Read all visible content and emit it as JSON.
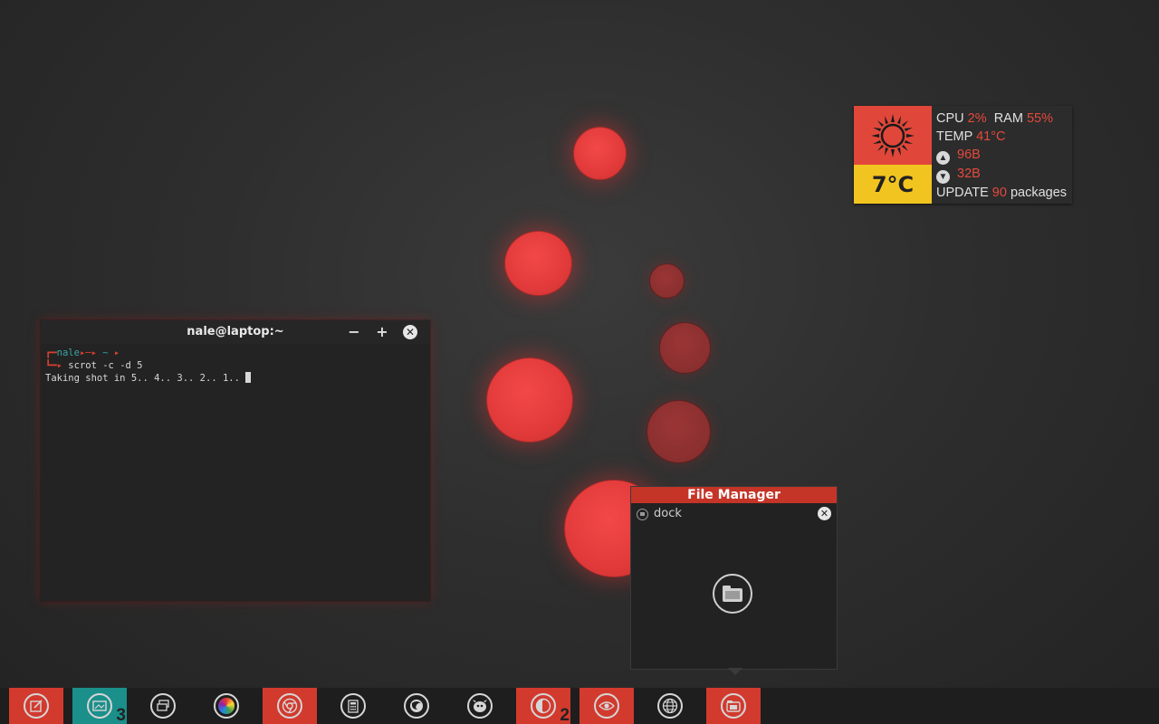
{
  "terminal": {
    "title": "nale@laptop:~",
    "prompt_user": "nale",
    "prompt_tail_1": "▸─▸ ",
    "prompt_dir": "~",
    "prompt_tail_2": " ▸",
    "command": "scrot -c -d 5",
    "output": "Taking shot in 5.. 4.. 3.. 2.. 1.. "
  },
  "conky": {
    "temperature": "7°C",
    "cpu_label": "CPU",
    "cpu_value": "2%",
    "ram_label": "RAM",
    "ram_value": "55%",
    "temp_label": "TEMP",
    "temp_value": "41°C",
    "upload_value": "96B",
    "download_value": "32B",
    "update_label": "UPDATE",
    "update_value": "90",
    "update_suffix": "packages"
  },
  "file_manager": {
    "title": "File Manager",
    "location": "dock"
  },
  "taskbar": {
    "items": [
      {
        "icon": "edit-icon",
        "active": "red",
        "count": ""
      },
      {
        "icon": "image-viewer-icon",
        "active": "teal",
        "count": "3"
      },
      {
        "icon": "window-switch-icon",
        "active": "",
        "count": ""
      },
      {
        "icon": "color-wheel-icon",
        "active": "",
        "count": ""
      },
      {
        "icon": "chrome-browser-icon",
        "active": "red",
        "count": ""
      },
      {
        "icon": "calculator-icon",
        "active": "",
        "count": ""
      },
      {
        "icon": "firefox-icon",
        "active": "",
        "count": ""
      },
      {
        "icon": "gimp-icon",
        "active": "",
        "count": ""
      },
      {
        "icon": "terminal-app-icon",
        "active": "red",
        "count": "2"
      },
      {
        "icon": "eye-icon",
        "active": "red",
        "count": ""
      },
      {
        "icon": "globe-icon",
        "active": "",
        "count": ""
      },
      {
        "icon": "file-manager-icon",
        "active": "red",
        "count": ""
      }
    ]
  },
  "colors": {
    "accent_red": "#d23a2e",
    "accent_teal": "#1b8f8a",
    "accent_yellow": "#f2c41f"
  }
}
